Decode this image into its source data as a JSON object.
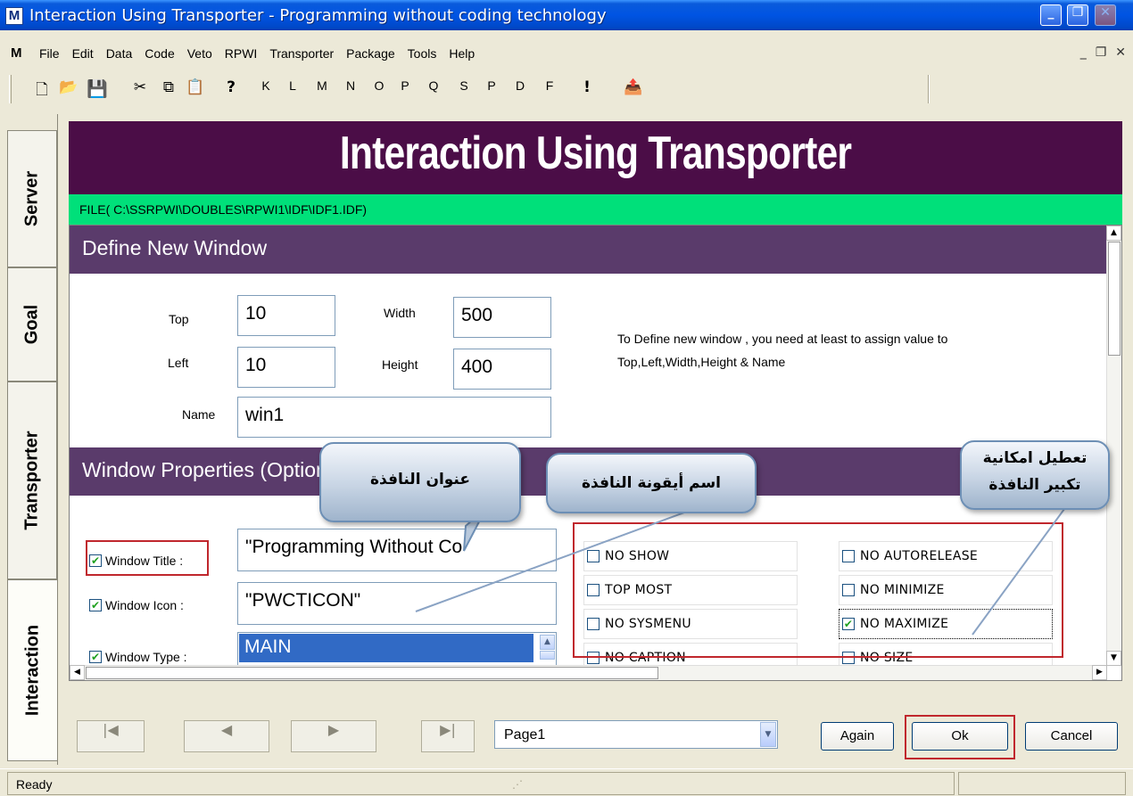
{
  "window": {
    "app_icon": "M",
    "title": "Interaction Using Transporter - Programming without coding technology",
    "controls": [
      "_",
      "❐",
      "✕"
    ]
  },
  "menu": {
    "logo": "M",
    "items": [
      "File",
      "Edit",
      "Data",
      "Code",
      "Veto",
      "RPWI",
      "Transporter",
      "Package",
      "Tools",
      "Help"
    ],
    "mdi": [
      "_",
      "❐",
      "✕"
    ]
  },
  "toolbar": {
    "icons": [
      "new-file-icon",
      "open-folder-icon",
      "save-icon",
      "cut-icon",
      "copy-icon",
      "paste-icon",
      "help-icon",
      "open-icon"
    ],
    "letters": [
      "K",
      "L",
      "M",
      "N",
      "O",
      "P",
      "Q",
      "S",
      "P",
      "D",
      "F"
    ],
    "bang": "!"
  },
  "left_tabs": [
    "Server",
    "Goal",
    "Transporter",
    "Interaction"
  ],
  "header": {
    "title": "Interaction Using Transporter",
    "file_path": "FILE( C:\\SSRPWI\\DOUBLES\\RPWI1\\IDF\\IDF1.IDF)"
  },
  "define_window": {
    "section_title": "Define New Window",
    "top_label": "Top",
    "top_value": "10",
    "left_label": "Left",
    "left_value": "10",
    "width_label": "Width",
    "width_value": "500",
    "height_label": "Height",
    "height_value": "400",
    "name_label": "Name",
    "name_value": "win1",
    "info_line1": "To Define new window , you need at least to assign value to",
    "info_line2": "Top,Left,Width,Height & Name"
  },
  "properties": {
    "section_title": "Window Properties (Optional)",
    "window_title_label": "Window Title :",
    "window_title_value": "\"Programming Without Co",
    "window_icon_label": "Window Icon :",
    "window_icon_value": "\"PWCTICON\"",
    "window_type_label": "Window Type :",
    "window_type_value": "MAIN",
    "options_left": [
      {
        "label": "NO SHOW",
        "checked": false
      },
      {
        "label": "TOP MOST",
        "checked": false
      },
      {
        "label": "NO SYSMENU",
        "checked": false
      },
      {
        "label": "NO CAPTION",
        "checked": false
      }
    ],
    "options_right": [
      {
        "label": "NO AUTORELEASE",
        "checked": false
      },
      {
        "label": "NO MINIMIZE",
        "checked": false
      },
      {
        "label": "NO MAXIMIZE",
        "checked": true
      },
      {
        "label": "NO SIZE",
        "checked": false
      }
    ],
    "check_mark": "✔"
  },
  "callouts": {
    "window_title": "عنوان النافذة",
    "window_icon": "اسم أيقونة النافذة",
    "disable_maximize_line1": "تعطيل امكانية",
    "disable_maximize_line2": "تكبير النافذة"
  },
  "navigation": {
    "first": "|◀",
    "prev": "◀",
    "next": "▶",
    "last": "▶|",
    "page_value": "Page1",
    "again_label": "Again",
    "ok_label": "Ok",
    "cancel_label": "Cancel"
  },
  "status": {
    "text": "Ready",
    "grip": "⋰"
  },
  "colors": {
    "header_band": "#4b0d47",
    "file_bar": "#00e07a",
    "section_head": "#5a3b6b",
    "highlight_red": "#c0272d",
    "selection_blue": "#316ac5"
  }
}
